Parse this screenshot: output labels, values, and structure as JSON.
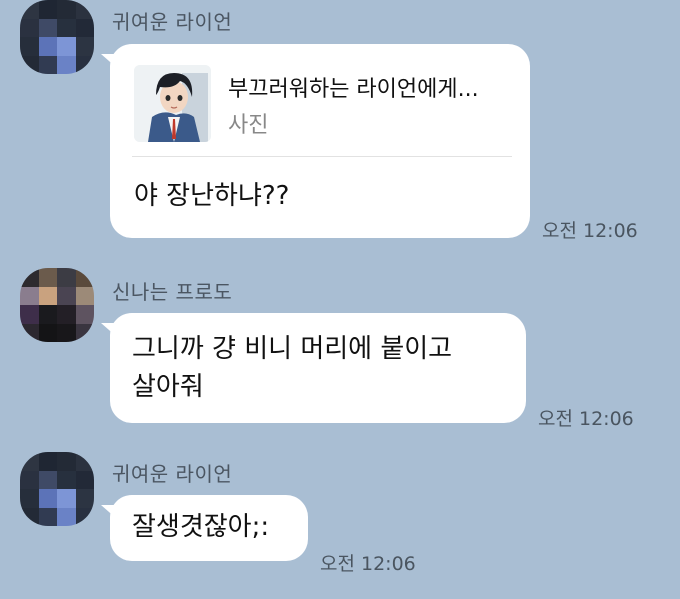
{
  "messages": [
    {
      "sender": "귀여운 라이언",
      "share": {
        "title": "부끄러워하는 라이언에게...",
        "subtitle": "사진"
      },
      "text": "야 장난하냐??",
      "time": "오전 12:06"
    },
    {
      "sender": "신나는 프로도",
      "lines": [
        "그니까 걍 비니 머리에 붙이고",
        "살아줘"
      ],
      "time": "오전 12:06"
    },
    {
      "sender": "귀여운 라이언",
      "text": "잘생겻잖아;:",
      "time": "오전 12:06"
    }
  ],
  "colors": {
    "background": "#a9bed3",
    "bubble": "#ffffff",
    "sender_text": "#4b5662",
    "time_text": "#4a5560"
  },
  "icons": {
    "avatar_1": "pixelated-avatar-icon",
    "avatar_2": "pixelated-avatar-icon",
    "avatar_3": "pixelated-avatar-icon",
    "share_thumbnail": "anime-boy-thumbnail"
  }
}
